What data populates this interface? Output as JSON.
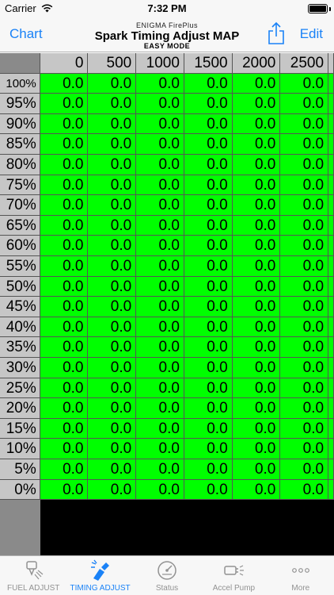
{
  "status_bar": {
    "carrier": "Carrier",
    "time": "7:32 PM"
  },
  "nav": {
    "left_button": "Chart",
    "subtitle": "ENIGMA FirePlus",
    "title": "Spark Timing Adjust MAP",
    "mode": "EASY MODE",
    "right_button": "Edit"
  },
  "grid": {
    "columns": [
      "0",
      "500",
      "1000",
      "1500",
      "2000",
      "2500"
    ],
    "rows": [
      "100%",
      "95%",
      "90%",
      "85%",
      "80%",
      "75%",
      "70%",
      "65%",
      "60%",
      "55%",
      "50%",
      "45%",
      "40%",
      "35%",
      "30%",
      "25%",
      "20%",
      "15%",
      "10%",
      "5%",
      "0%"
    ],
    "cell_value": "0.0",
    "cell_color": "#00ff00"
  },
  "tabs": [
    {
      "label": "FUEL ADJUST",
      "icon": "fuel-injector-icon",
      "active": false
    },
    {
      "label": "TIMING ADJUST",
      "icon": "spark-plug-icon",
      "active": true
    },
    {
      "label": "Status",
      "icon": "gauge-icon",
      "active": false
    },
    {
      "label": "Accel Pump",
      "icon": "accel-pump-icon",
      "active": false
    },
    {
      "label": "More",
      "icon": "more-dots-icon",
      "active": false
    }
  ],
  "colors": {
    "accent": "#1a82f7",
    "tab_inactive": "#929292"
  }
}
